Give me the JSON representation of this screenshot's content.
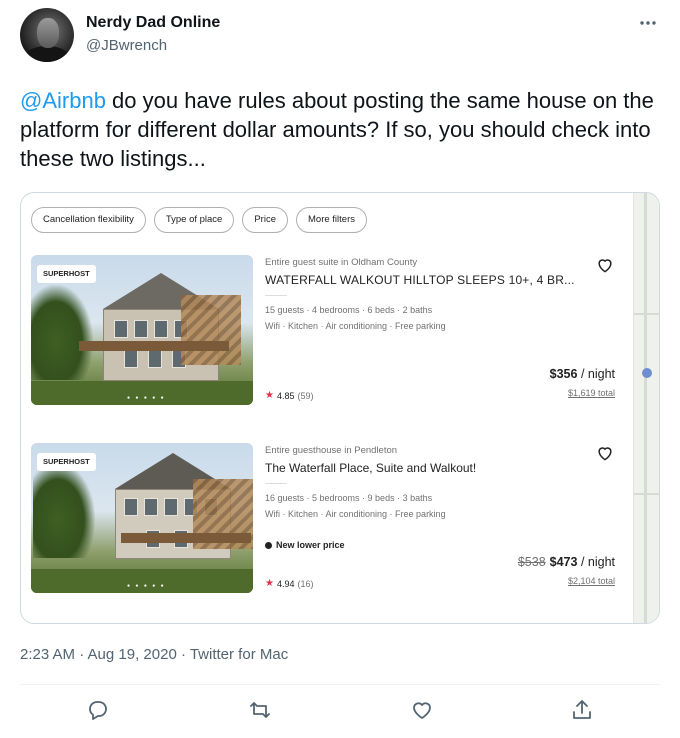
{
  "author": {
    "name": "Nerdy Dad Online",
    "handle": "@JBwrench"
  },
  "tweet": {
    "mention": "@Airbnb",
    "text": " do you have rules about posting the same house on the platform for different dollar amounts?  If so, you should check into these two listings..."
  },
  "media": {
    "filters": [
      "Cancellation flexibility",
      "Type of place",
      "Price",
      "More filters"
    ],
    "listings": [
      {
        "badge": "SUPERHOST",
        "subtitle": "Entire guest suite in Oldham County",
        "title": "WATERFALL WALKOUT HILLTOP SLEEPS 10+, 4 BR...",
        "details": "15 guests · 4 bedrooms · 6 beds · 2 baths",
        "amenities": "Wifi · Kitchen · Air conditioning · Free parking",
        "rating": "4.85",
        "reviews": "(59)",
        "price": "$356",
        "per": " / night",
        "total": "$1,619 total"
      },
      {
        "badge": "SUPERHOST",
        "subtitle": "Entire guesthouse in Pendleton",
        "title": "The Waterfall Place, Suite and Walkout!",
        "details": "16 guests · 5 bedrooms · 9 beds · 3 baths",
        "amenities": "Wifi · Kitchen · Air conditioning · Free parking",
        "promo": "New lower price",
        "rating": "4.94",
        "reviews": "(16)",
        "old_price": "$538",
        "price": "$473",
        "per": " / night",
        "total": "$2,104 total"
      }
    ]
  },
  "meta": {
    "timestamp": "2:23 AM · Aug 19, 2020 · Twitter for Mac"
  },
  "icons": {
    "more": "more-horizontal-icon",
    "reply": "reply-icon",
    "retweet": "retweet-icon",
    "like": "like-icon",
    "share": "share-icon"
  },
  "colors": {
    "link": "#1d9bf0",
    "muted": "#536471",
    "star": "#e0334b"
  }
}
